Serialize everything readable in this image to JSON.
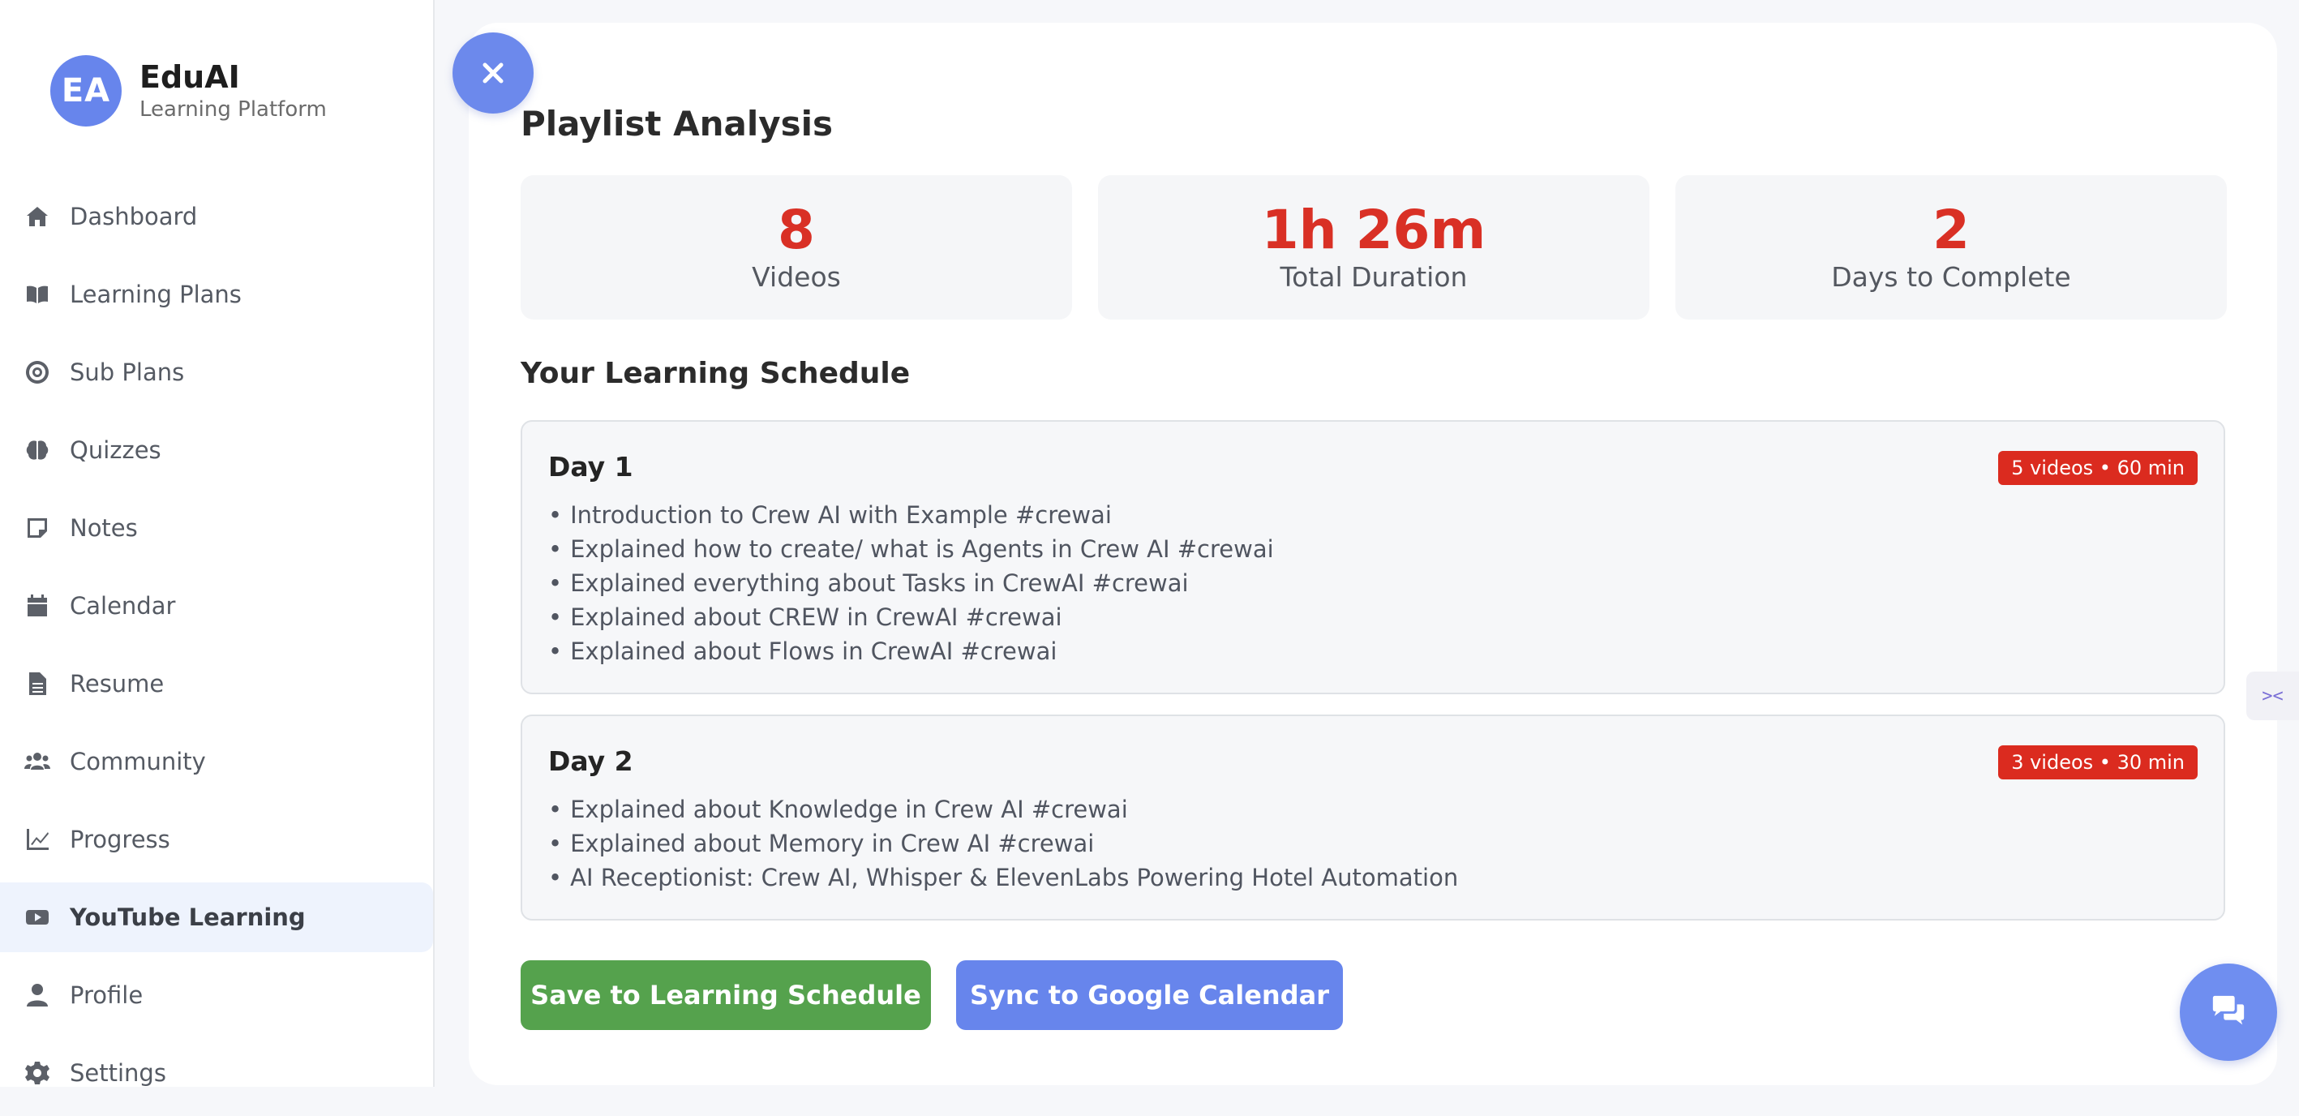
{
  "brand": {
    "initials": "EA",
    "name": "EduAI",
    "subtitle": "Learning Platform"
  },
  "nav": [
    {
      "label": "Dashboard",
      "icon": "home-icon",
      "active": false
    },
    {
      "label": "Learning Plans",
      "icon": "book-icon",
      "active": false
    },
    {
      "label": "Sub Plans",
      "icon": "target-icon",
      "active": false
    },
    {
      "label": "Quizzes",
      "icon": "brain-icon",
      "active": false
    },
    {
      "label": "Notes",
      "icon": "note-icon",
      "active": false
    },
    {
      "label": "Calendar",
      "icon": "calendar-icon",
      "active": false
    },
    {
      "label": "Resume",
      "icon": "file-icon",
      "active": false
    },
    {
      "label": "Community",
      "icon": "users-icon",
      "active": false
    },
    {
      "label": "Progress",
      "icon": "chart-line-icon",
      "active": false
    },
    {
      "label": "YouTube Learning",
      "icon": "youtube-icon",
      "active": true
    },
    {
      "label": "Profile",
      "icon": "user-icon",
      "active": false
    },
    {
      "label": "Settings",
      "icon": "gear-icon",
      "active": false
    }
  ],
  "analysis": {
    "title": "Playlist Analysis",
    "stats": [
      {
        "value": "8",
        "label": "Videos"
      },
      {
        "value": "1h 26m",
        "label": "Total Duration"
      },
      {
        "value": "2",
        "label": "Days to Complete"
      }
    ]
  },
  "schedule": {
    "title": "Your Learning Schedule",
    "days": [
      {
        "title": "Day 1",
        "badge": "5 videos • 60 min",
        "videos": [
          "Introduction to Crew AI with Example #crewai",
          "Explained how to create/ what is Agents in Crew AI #crewai",
          "Explained everything about Tasks in CrewAI #crewai",
          "Explained about CREW in CrewAI #crewai",
          "Explained about Flows in CrewAI #crewai"
        ]
      },
      {
        "title": "Day 2",
        "badge": "3 videos • 30 min",
        "videos": [
          "Explained about Knowledge in Crew AI #crewai",
          "Explained about Memory in Crew AI #crewai",
          "AI Receptionist: Crew AI, Whisper & ElevenLabs Powering Hotel Automation"
        ]
      }
    ]
  },
  "actions": {
    "save_label": "Save to Learning Schedule",
    "sync_label": "Sync to Google Calendar"
  },
  "colors": {
    "accent": "#6785ec",
    "stat_value": "#d93025",
    "badge": "#db2b1f",
    "save_button": "#55a24d"
  }
}
